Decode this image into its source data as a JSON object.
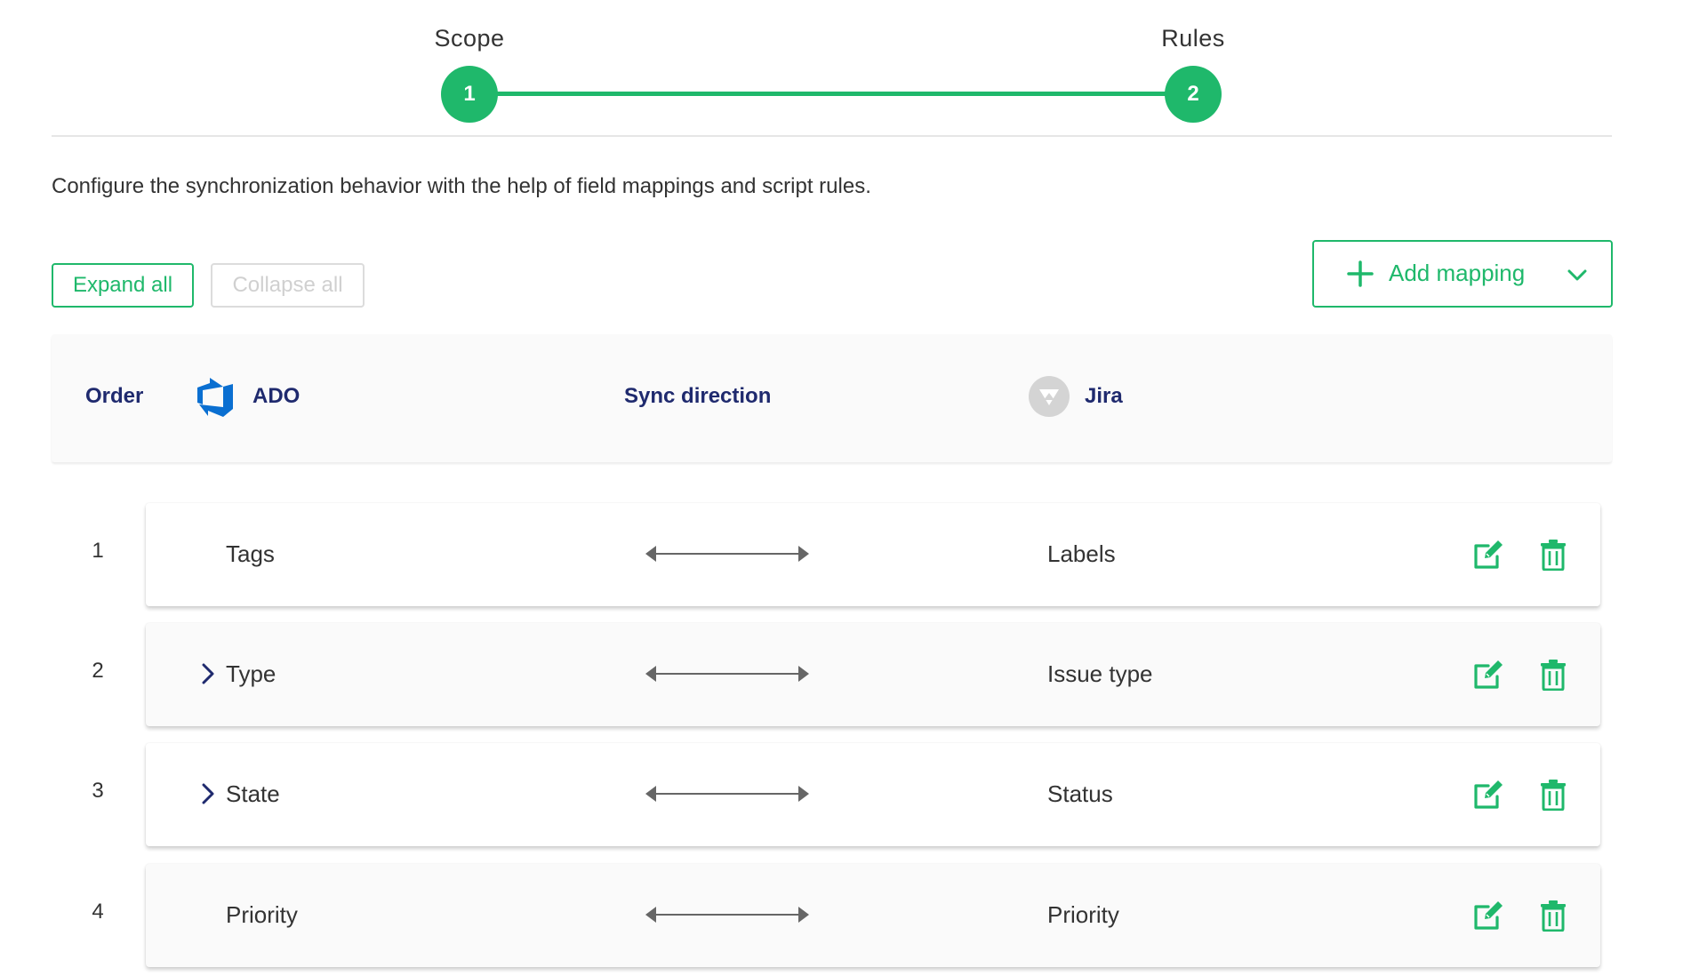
{
  "colors": {
    "accent": "#1fb86b",
    "header_text": "#1f2a6e",
    "ado_blue": "#0a6fd1",
    "muted_border": "#dcdcdc",
    "muted_text": "#d0d0d0",
    "arrow": "#666666"
  },
  "stepper": {
    "steps": [
      {
        "number": "1",
        "label": "Scope"
      },
      {
        "number": "2",
        "label": "Rules"
      }
    ]
  },
  "intro_text": "Configure the synchronization behavior with the help of field mappings and script rules.",
  "toolbar": {
    "expand_label": "Expand all",
    "collapse_label": "Collapse all",
    "add_label": "Add mapping",
    "add_icon": "plus-icon",
    "dropdown_icon": "chevron-down-icon"
  },
  "table": {
    "headers": {
      "order": "Order",
      "ado": "ADO",
      "sync": "Sync direction",
      "jira": "Jira"
    },
    "rows": [
      {
        "order": "1",
        "ado": "Tags",
        "jira": "Labels",
        "expandable": false
      },
      {
        "order": "2",
        "ado": "Type",
        "jira": "Issue type",
        "expandable": true
      },
      {
        "order": "3",
        "ado": "State",
        "jira": "Status",
        "expandable": true
      },
      {
        "order": "4",
        "ado": "Priority",
        "jira": "Priority",
        "expandable": false
      }
    ]
  }
}
